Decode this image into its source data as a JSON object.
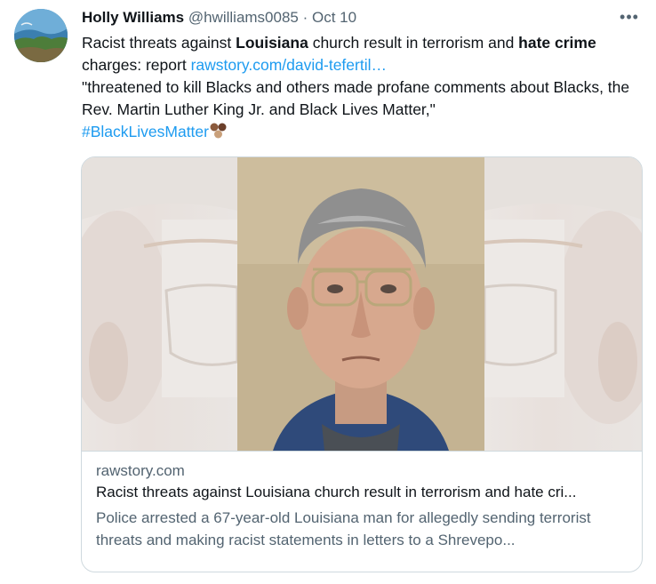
{
  "tweet": {
    "author_name": "Holly Williams",
    "author_handle": "@hwilliams0085",
    "separator": "·",
    "date": "Oct 10",
    "more_label": "•••",
    "text": {
      "part1": "Racist threats against ",
      "bold1": "Louisiana",
      "part2": " church result in terrorism and ",
      "bold2": "hate crime",
      "part3": " charges: report ",
      "link": "rawstory.com/david-tefertil…",
      "quote": "\"threatened to kill Blacks and others made profane comments about Blacks, the Rev. Martin Luther King Jr. and Black Lives Matter,\"",
      "hashtag": "#BlackLivesMatter"
    },
    "hashtag_emoji": "blm-fists-emoji"
  },
  "card": {
    "domain": "rawstory.com",
    "title": "Racist threats against Louisiana church result in terrorism and hate cri...",
    "description": "Police arrested a 67-year-old Louisiana man for allegedly sending terrorist threats and making racist statements in letters to a Shrevepo..."
  },
  "colors": {
    "link": "#1d9bf0",
    "secondary_text": "#536471",
    "border": "#cfd9de"
  }
}
